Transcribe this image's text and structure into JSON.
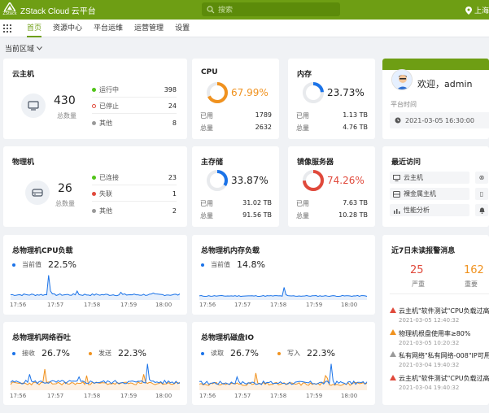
{
  "app": {
    "logo": "ZStack",
    "title": "ZStack Cloud 云平台",
    "location_icon": "location-icon"
  },
  "search": {
    "placeholder": "搜索"
  },
  "location": {
    "label": "上海"
  },
  "nav": {
    "items": [
      {
        "label": "首页",
        "active": true
      },
      {
        "label": "资源中心"
      },
      {
        "label": "平台运维"
      },
      {
        "label": "运营管理"
      },
      {
        "label": "设置"
      }
    ]
  },
  "region": {
    "label": "当前区域"
  },
  "vm": {
    "title": "云主机",
    "total": "430",
    "total_label": "总数量",
    "stats": [
      {
        "label": "运行中",
        "value": "398",
        "color": "#52c41a"
      },
      {
        "label": "已停止",
        "value": "24",
        "color": "#e0493b"
      },
      {
        "label": "其他",
        "value": "8",
        "color": "#999999"
      }
    ]
  },
  "host": {
    "title": "物理机",
    "total": "26",
    "total_label": "总数量",
    "stats": [
      {
        "label": "已连接",
        "value": "23",
        "color": "#52c41a"
      },
      {
        "label": "失联",
        "value": "1",
        "color": "#e0493b"
      },
      {
        "label": "其他",
        "value": "2",
        "color": "#999999"
      }
    ]
  },
  "cpu": {
    "title": "CPU",
    "percent": "67.99%",
    "pct_value": 67.99,
    "color": "#f0921f",
    "used_label": "已用",
    "used": "1789",
    "total_label": "总量",
    "total": "2632"
  },
  "mem": {
    "title": "内存",
    "percent": "23.73%",
    "pct_value": 23.73,
    "color": "#1b73e8",
    "used_label": "已用",
    "used": "1.13 TB",
    "total_label": "总量",
    "total": "4.76 TB"
  },
  "storage": {
    "title": "主存储",
    "percent": "33.87%",
    "pct_value": 33.87,
    "color": "#1b73e8",
    "used_label": "已用",
    "used": "31.02 TB",
    "total_label": "总量",
    "total": "91.56 TB"
  },
  "image": {
    "title": "镜像服务器",
    "percent": "74.26%",
    "pct_value": 74.26,
    "color": "#e0493b",
    "used_label": "已用",
    "used": "7.63 TB",
    "total_label": "总量",
    "total": "10.28 TB"
  },
  "welcome": {
    "greeting": "欢迎，admin",
    "time_label": "平台时间",
    "time": "2021-03-05 16:30:00"
  },
  "recent": {
    "title": "最近访问",
    "items": [
      {
        "label": "云主机",
        "icon": "monitor-icon"
      },
      {
        "label": "裸金属主机",
        "icon": "server-icon"
      },
      {
        "label": "性能分析",
        "icon": "bar-chart-icon"
      }
    ]
  },
  "cpu_load": {
    "title": "总物理机CPU负载",
    "legend": [
      {
        "label": "当前值",
        "value": "22.5%",
        "color": "#1b73e8"
      }
    ],
    "x_ticks": [
      "17:56",
      "17:57",
      "17:58",
      "17:59",
      "18:00"
    ]
  },
  "mem_load": {
    "title": "总物理机内存负载",
    "legend": [
      {
        "label": "当前值",
        "value": "14.8%",
        "color": "#1b73e8"
      }
    ],
    "x_ticks": [
      "17:56",
      "17:57",
      "17:58",
      "17:59",
      "18:00"
    ]
  },
  "net": {
    "title": "总物理机网络吞吐",
    "legend": [
      {
        "label": "接收",
        "value": "26.7%",
        "color": "#1b73e8"
      },
      {
        "label": "发送",
        "value": "22.3%",
        "color": "#f0921f"
      }
    ],
    "x_ticks": [
      "17:56",
      "17:57",
      "17:58",
      "17:59",
      "18:00"
    ]
  },
  "disk": {
    "title": "总物理机磁盘IO",
    "legend": [
      {
        "label": "读取",
        "value": "26.7%",
        "color": "#1b73e8"
      },
      {
        "label": "写入",
        "value": "22.3%",
        "color": "#f0921f"
      }
    ],
    "x_ticks": [
      "17:56",
      "17:57",
      "17:58",
      "17:59",
      "18:00"
    ]
  },
  "alerts": {
    "title": "近7日未读报警消息",
    "severe_count": "25",
    "severe_label": "严重",
    "severe_color": "#e0493b",
    "important_count": "162",
    "important_label": "重要",
    "important_color": "#f0921f",
    "items": [
      {
        "title": "云主机\"软件测试\"CPU负载过高",
        "time": "2021-03-05 12:40:32",
        "color": "#e0493b"
      },
      {
        "title": "物理机根盘使用率≥80%",
        "time": "2021-03-05 10:20:32",
        "color": "#f0921f"
      },
      {
        "title": "私有网络\"私有网络-008\"IP可用",
        "time": "2021-03-04 19:40:32",
        "color": "#999999"
      },
      {
        "title": "云主机\"软件测试\"CPU负载过高",
        "time": "2021-03-04 19:40:32",
        "color": "#e0493b"
      }
    ]
  }
}
